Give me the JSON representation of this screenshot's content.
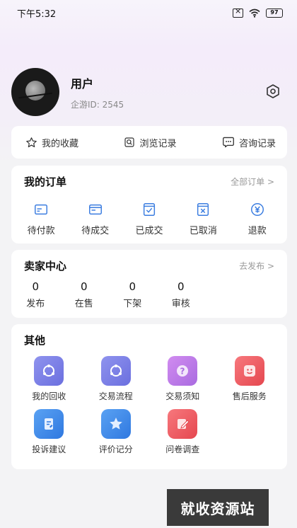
{
  "status_bar": {
    "time": "下午5:32",
    "battery": "97"
  },
  "profile": {
    "name": "用户",
    "user_id": "企游ID: 2545"
  },
  "quick_links": [
    {
      "label": "我的收藏",
      "icon": "star-icon"
    },
    {
      "label": "浏览记录",
      "icon": "history-icon"
    },
    {
      "label": "咨询记录",
      "icon": "chat-icon"
    }
  ],
  "orders": {
    "title": "我的订单",
    "view_all": "全部订单 >",
    "items": [
      {
        "label": "待付款",
        "icon": "card-icon"
      },
      {
        "label": "待成交",
        "icon": "list-card-icon"
      },
      {
        "label": "已成交",
        "icon": "check-icon"
      },
      {
        "label": "已取消",
        "icon": "cancel-icon"
      },
      {
        "label": "退款",
        "icon": "yen-icon"
      }
    ]
  },
  "seller": {
    "title": "卖家中心",
    "publish": "去发布 >",
    "items": [
      {
        "count": "0",
        "label": "发布"
      },
      {
        "count": "0",
        "label": "在售"
      },
      {
        "count": "0",
        "label": "下架"
      },
      {
        "count": "0",
        "label": "审核"
      }
    ]
  },
  "other": {
    "title": "其他",
    "items": [
      {
        "label": "我的回收",
        "icon": "recycle-icon",
        "color": "#7b7fe6"
      },
      {
        "label": "交易流程",
        "icon": "flow-icon",
        "color": "#7b7fe6"
      },
      {
        "label": "交易须知",
        "icon": "question-icon",
        "color": "#c07ce8"
      },
      {
        "label": "售后服务",
        "icon": "smile-icon",
        "color": "#ef5a62"
      },
      {
        "label": "投诉建议",
        "icon": "complaint-icon",
        "color": "#3f8bea"
      },
      {
        "label": "评价记分",
        "icon": "star-icon",
        "color": "#3f8bea"
      },
      {
        "label": "问卷调查",
        "icon": "pencil-icon",
        "color": "#ef5a62"
      }
    ]
  },
  "watermark": "就收资源站"
}
